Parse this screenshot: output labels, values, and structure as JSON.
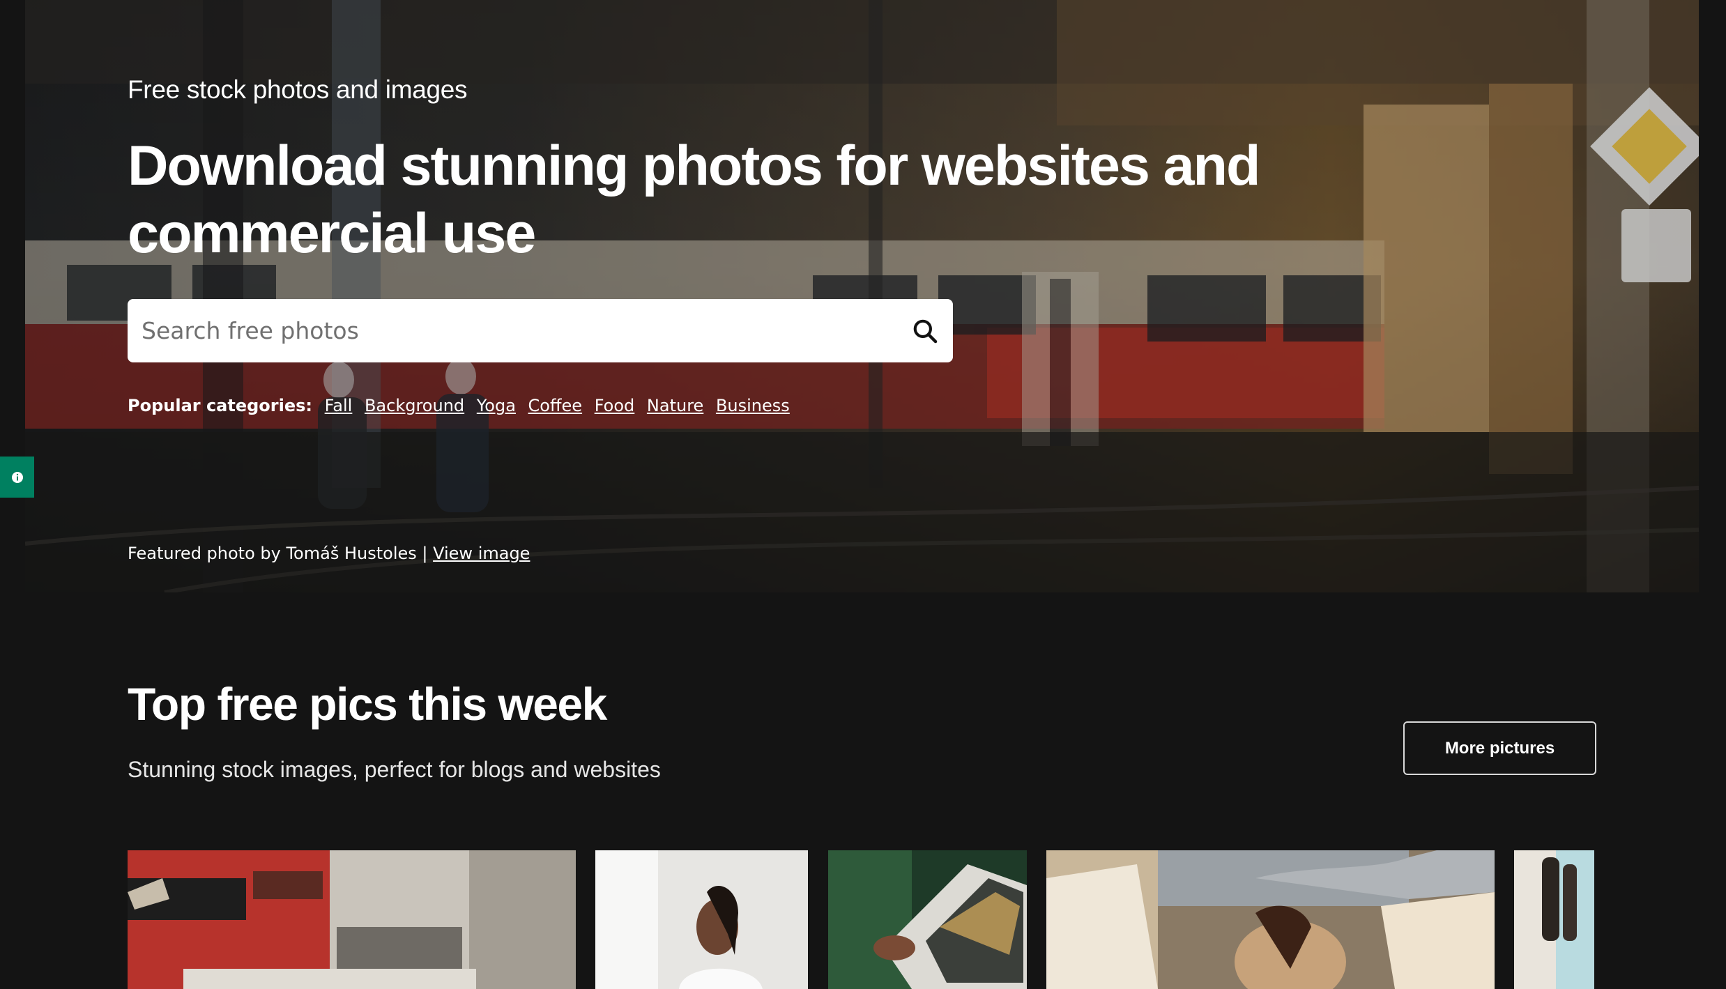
{
  "hero": {
    "eyebrow": "Free stock photos and images",
    "headline": "Download stunning photos for websites and commercial use",
    "search": {
      "placeholder": "Search free photos"
    },
    "popular_label": "Popular categories:",
    "categories": [
      "Fall",
      "Background",
      "Yoga",
      "Coffee",
      "Food",
      "Nature",
      "Business"
    ],
    "credit_prefix": "Featured photo by Tomáš Hustoles |",
    "credit_link": "View image"
  },
  "top_pics": {
    "title": "Top free pics this week",
    "subtitle": "Stunning stock images, perfect for blogs and websites",
    "more_button": "More pictures"
  },
  "colors": {
    "background": "#141414",
    "accent_green": "#008060"
  },
  "icons": {
    "search": "search-icon",
    "feedback": "info-icon"
  }
}
